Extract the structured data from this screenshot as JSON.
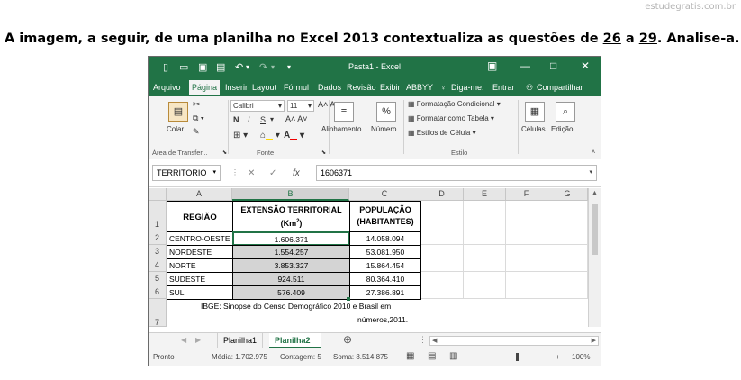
{
  "watermark": "estudegratis.com.br",
  "question": {
    "prefix": "A imagem, a seguir, de uma planilha no Excel 2013 contextualiza as questões de ",
    "q_from": "26",
    "connector": " a ",
    "q_to": "29",
    "suffix": ". Analise-a."
  },
  "window": {
    "title": "Pasta1 - Excel",
    "tabs": [
      "Arquivo",
      "Página",
      "Inserir",
      "Layout",
      "Fórmul",
      "Dados",
      "Revisão",
      "Exibir",
      "ABBYY",
      "Diga-me.",
      "Entrar",
      "Compartilhar"
    ],
    "active_tab": "Página"
  },
  "ribbon": {
    "paste_label": "Colar",
    "clipboard_group": "Área de Transfer...",
    "font_name": "Calibri",
    "font_size": "11",
    "bold": "N",
    "italic": "I",
    "underline": "S",
    "font_group": "Fonte",
    "alignment_label": "Alinhamento",
    "number_label": "Número",
    "number_symbol": "%",
    "conditional_formatting": "Formatação Condicional",
    "format_as_table": "Formatar como Tabela",
    "cell_styles": "Estilos de Célula",
    "styles_group": "Estilo",
    "cells_label": "Células",
    "editing_label": "Edição"
  },
  "formula_bar": {
    "name_box": "TERRITORIO",
    "fx": "fx",
    "value": "1606371"
  },
  "sheet": {
    "columns": [
      "A",
      "B",
      "C",
      "D",
      "E",
      "F",
      "G"
    ],
    "rows": [
      "1",
      "2",
      "3",
      "4",
      "5",
      "6",
      "7"
    ],
    "header": {
      "regiao": "REGIÃO",
      "extensao_line1": "EXTENSÃO TERRITORIAL",
      "extensao_line2": "(Km",
      "extensao_sup": "2",
      "extensao_close": ")",
      "populacao_line1": "POPULAÇÃO",
      "populacao_line2": "(HABITANTES)"
    },
    "data": [
      {
        "regiao": "CENTRO-OESTE",
        "extensao": "1.606.371",
        "populacao": "14.058.094"
      },
      {
        "regiao": "NORDESTE",
        "extensao": "1.554.257",
        "populacao": "53.081.950"
      },
      {
        "regiao": "NORTE",
        "extensao": "3.853.327",
        "populacao": "15.864.454"
      },
      {
        "regiao": "SUDESTE",
        "extensao": "924.511",
        "populacao": "80.364.410"
      },
      {
        "regiao": "SUL",
        "extensao": "576.409",
        "populacao": "27.386.891"
      }
    ],
    "source_line1": "IBGE: Sinopse do Censo Demográfico 2010 e Brasil em",
    "source_line2": "números,2011."
  },
  "sheet_tabs": [
    "Planilha1",
    "Planilha2"
  ],
  "active_sheet": "Planilha2",
  "status": {
    "mode": "Pronto",
    "average": "Média: 1.702.975",
    "count": "Contagem: 5",
    "sum": "Soma: 8.514.875",
    "zoom": "100%"
  },
  "colors": {
    "excel_green": "#217346",
    "selection_gray": "#d4d4d4"
  }
}
